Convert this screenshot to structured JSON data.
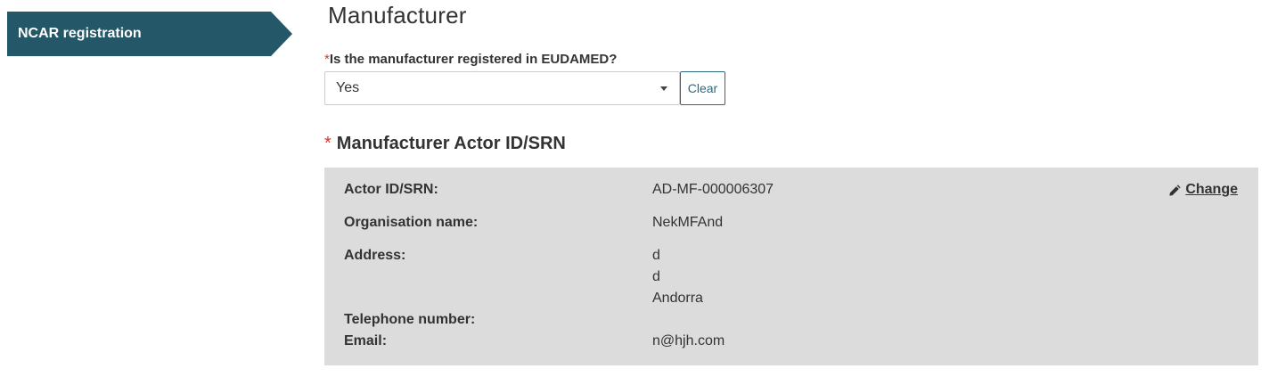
{
  "sidebar": {
    "step_label": "NCAR registration"
  },
  "page": {
    "title": "Manufacturer"
  },
  "registered_question": {
    "required_mark": "*",
    "label": "Is the manufacturer registered in EUDAMED?",
    "selected_value": "Yes",
    "clear_label": "Clear"
  },
  "actor_section": {
    "required_mark": "*",
    "title": "Manufacturer Actor ID/SRN",
    "change_label": " Change",
    "change_icon": "pencil-icon",
    "fields": {
      "actor_id_label": "Actor ID/SRN:",
      "actor_id_value": "AD-MF-000006307",
      "org_name_label": "Organisation name:",
      "org_name_value": "NekMFAnd",
      "address_label": "Address:",
      "address_line1": "d",
      "address_line2": "d",
      "address_country": "Andorra",
      "telephone_label": "Telephone number:",
      "telephone_value": "",
      "email_label": "Email:",
      "email_value": "n@hjh.com"
    }
  }
}
